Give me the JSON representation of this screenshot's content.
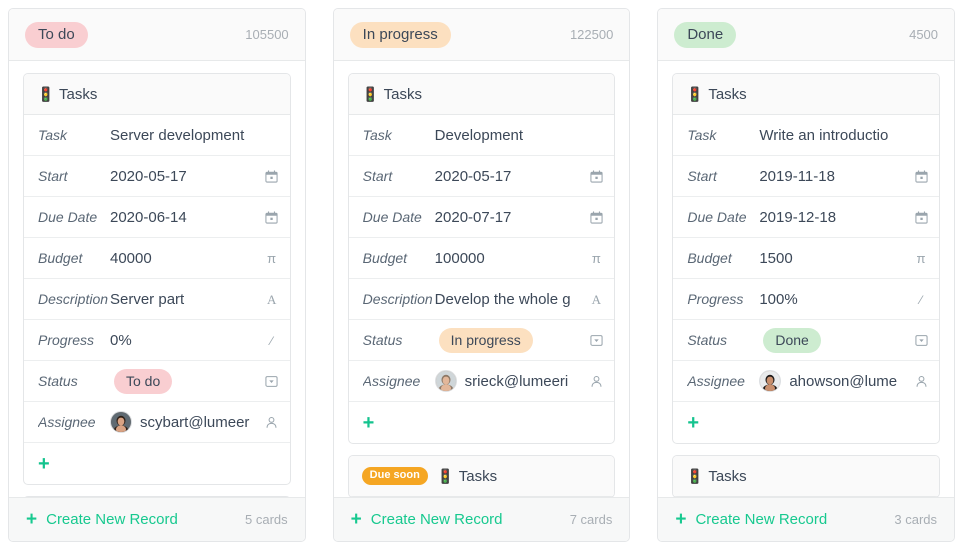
{
  "theme": {
    "accent": "#17c98f",
    "todo_bg": "#f9ced1",
    "progress_bg": "#fce0c0",
    "done_bg": "#cdecd0",
    "due_soon_bg": "#f5a623",
    "text": "#3c4858",
    "muted": "#a8aeb4"
  },
  "footer": {
    "create_label": "Create New Record",
    "plus": "+"
  },
  "columns": [
    {
      "name": "To do",
      "pill_class": "pill-todo",
      "sum": "105500",
      "card_count": "5 cards",
      "cards": [
        {
          "title": "Tasks",
          "icon": "traffic-light-icon",
          "icon_glyph": "🚦",
          "due_badge": null,
          "rows": [
            {
              "label": "Task",
              "value": "Server development",
              "type": "text",
              "icon": null
            },
            {
              "label": "Start",
              "value": "2020-05-17",
              "type": "text",
              "icon": "calendar-icon"
            },
            {
              "label": "Due Date",
              "value": "2020-06-14",
              "type": "text",
              "icon": "calendar-icon"
            },
            {
              "label": "Budget",
              "value": "40000",
              "type": "text",
              "icon": "number-pi-icon"
            },
            {
              "label": "Description",
              "value": "Server part",
              "type": "text",
              "icon": "text-a-icon"
            },
            {
              "label": "Progress",
              "value": "0%",
              "type": "text",
              "icon": "percent-icon"
            },
            {
              "label": "Status",
              "value": "To do",
              "type": "pill",
              "pill_class": "pill-todo",
              "icon": "select-box-icon"
            },
            {
              "label": "Assignee",
              "value": "scybart@lumeer",
              "type": "user",
              "avatar": "avatar-female-1",
              "icon": "user-icon"
            }
          ],
          "add_row": "+"
        },
        {
          "title": "",
          "icon": null,
          "icon_glyph": "",
          "due_badge": null,
          "partial": true,
          "rows": []
        }
      ]
    },
    {
      "name": "In progress",
      "pill_class": "pill-progress",
      "sum": "122500",
      "card_count": "7 cards",
      "cards": [
        {
          "title": "Tasks",
          "icon": "traffic-light-icon",
          "icon_glyph": "🚦",
          "due_badge": null,
          "rows": [
            {
              "label": "Task",
              "value": "Development",
              "type": "text",
              "icon": null
            },
            {
              "label": "Start",
              "value": "2020-05-17",
              "type": "text",
              "icon": "calendar-icon"
            },
            {
              "label": "Due Date",
              "value": "2020-07-17",
              "type": "text",
              "icon": "calendar-icon"
            },
            {
              "label": "Budget",
              "value": "100000",
              "type": "text",
              "icon": "number-pi-icon"
            },
            {
              "label": "Description",
              "value": "Develop the whole g",
              "type": "text",
              "icon": "text-a-icon"
            },
            {
              "label": "Status",
              "value": "In progress",
              "type": "pill",
              "pill_class": "pill-progress",
              "icon": "select-box-icon"
            },
            {
              "label": "Assignee",
              "value": "srieck@lumeeri",
              "type": "user",
              "avatar": "avatar-female-2",
              "icon": "user-icon"
            }
          ],
          "add_row": "+"
        },
        {
          "title": "Tasks",
          "icon": "traffic-light-icon",
          "icon_glyph": "🚦",
          "due_badge": "Due soon",
          "partial": true,
          "rows": []
        }
      ]
    },
    {
      "name": "Done",
      "pill_class": "pill-done",
      "sum": "4500",
      "card_count": "3 cards",
      "cards": [
        {
          "title": "Tasks",
          "icon": "traffic-light-icon",
          "icon_glyph": "🚦",
          "due_badge": null,
          "rows": [
            {
              "label": "Task",
              "value": "Write an introductio",
              "type": "text",
              "icon": null
            },
            {
              "label": "Start",
              "value": "2019-11-18",
              "type": "text",
              "icon": "calendar-icon"
            },
            {
              "label": "Due Date",
              "value": "2019-12-18",
              "type": "text",
              "icon": "calendar-icon"
            },
            {
              "label": "Budget",
              "value": "1500",
              "type": "text",
              "icon": "number-pi-icon"
            },
            {
              "label": "Progress",
              "value": "100%",
              "type": "text",
              "icon": "percent-icon"
            },
            {
              "label": "Status",
              "value": "Done",
              "type": "pill",
              "pill_class": "pill-done",
              "icon": "select-box-icon"
            },
            {
              "label": "Assignee",
              "value": "ahowson@lume",
              "type": "user",
              "avatar": "avatar-female-3",
              "icon": "user-icon"
            }
          ],
          "add_row": "+"
        },
        {
          "title": "Tasks",
          "icon": "traffic-light-icon",
          "icon_glyph": "🚦",
          "due_badge": null,
          "partial": true,
          "rows": []
        }
      ]
    }
  ]
}
